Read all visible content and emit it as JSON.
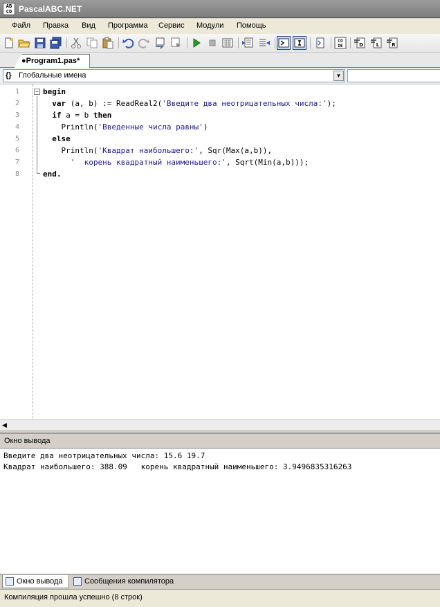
{
  "window": {
    "title": "PascalABC.NET",
    "icon_text": "AB\nCD"
  },
  "menu": {
    "items": [
      {
        "label": "Файл"
      },
      {
        "label": "Правка"
      },
      {
        "label": "Вид"
      },
      {
        "label": "Программа"
      },
      {
        "label": "Сервис"
      },
      {
        "label": "Модули"
      },
      {
        "label": "Помощь"
      }
    ]
  },
  "toolbar": {
    "buttons": [
      "new-file-icon",
      "open-folder-icon",
      "save-icon",
      "save-all-icon",
      "cut-icon",
      "copy-icon",
      "paste-icon",
      "undo-icon",
      "redo-icon",
      "compile-icon",
      "build-icon",
      "run-icon",
      "stop-icon",
      "debug-icon",
      "comment-icon",
      "uncomment-icon",
      "step-into-icon",
      "step-over-icon",
      "output-window-icon",
      "code-icon",
      "format-code-icon",
      "navigate-icon",
      "reference-icon"
    ]
  },
  "tabs": {
    "active_file": "●Program1.pas*"
  },
  "scope": {
    "selected": "Глобальные имена",
    "icon": "{}"
  },
  "editor": {
    "line_numbers": [
      "1",
      "2",
      "3",
      "4",
      "5",
      "6",
      "7",
      "8"
    ],
    "lines": [
      [
        "kw:begin"
      ],
      [
        "txt:  var (a, b) := ReadReal2(",
        "str:'Введите два неотрицательных числа:'",
        "txt:);"
      ],
      [
        "txt:  if a = b then"
      ],
      [
        "txt:    Println(",
        "str:'Введенные числа равны'",
        "txt:)"
      ],
      [
        "txt:  else"
      ],
      [
        "txt:    Println(",
        "str:'Квадрат наибольшего:'",
        "txt:, Sqr(Max(a,b)),"
      ],
      [
        "str:      '  корень квадратный наименьшего:'",
        "txt:, Sqrt(Min(a,b)));"
      ],
      [
        "txt:end."
      ]
    ]
  },
  "output": {
    "title": "Окно вывода",
    "lines": [
      "Введите два неотрицательных числа: 15.6 19.7",
      "Квадрат наибольшего: 388.09   корень квадратный наименьшего: 3.9496835316263"
    ]
  },
  "bottom_tabs": {
    "output_label": "Окно вывода",
    "messages_label": "Сообщения компилятора"
  },
  "status": {
    "text": "Компиляция прошла успешно (8 строк)"
  },
  "colors": {
    "string": "#1a1a8a",
    "keyword": "#000000",
    "titlebar": "#8a8a8a"
  }
}
